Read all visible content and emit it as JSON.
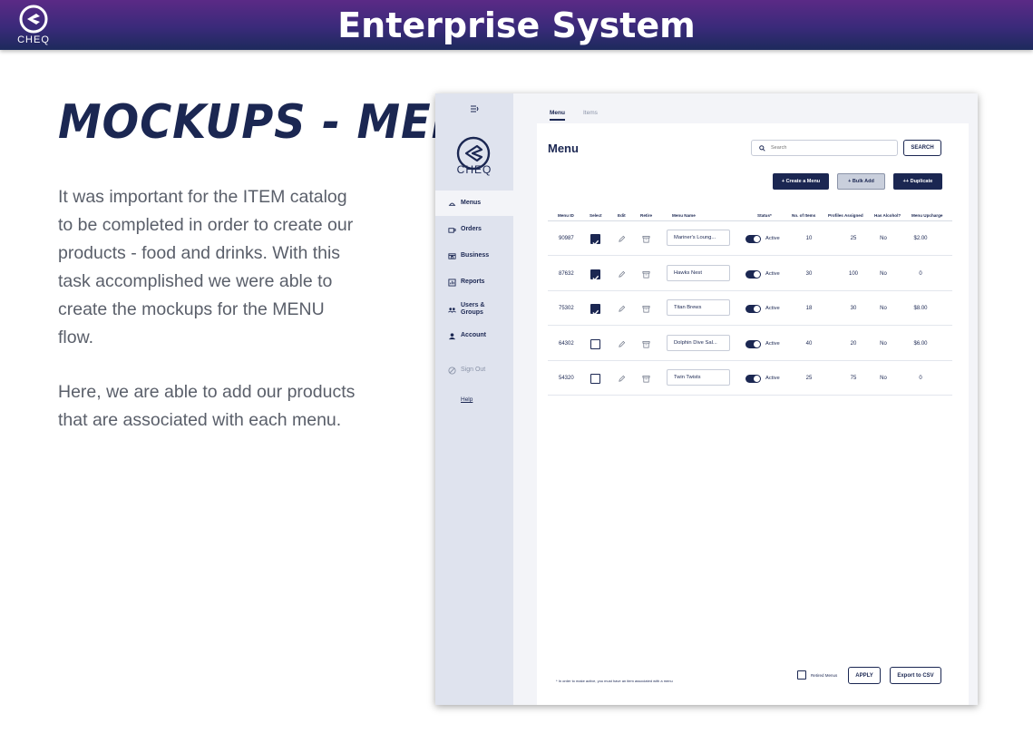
{
  "banner": {
    "logo_text": "CHEQ",
    "title": "Enterprise System",
    "logo_icon": "cheq-logo-icon"
  },
  "slide": {
    "heading": "MOCKUPS - MENU",
    "paragraph1": "It was important for the ITEM catalog to be completed in order to create our products - food and drinks. With this task accomplished we were able to create the mockups for the MENU flow.",
    "paragraph2": "Here, we are able to add our products that are associated with each menu."
  },
  "mockup": {
    "sidebar": {
      "logo_text": "CHEQ",
      "items": [
        {
          "label": "Menus",
          "icon": "menu-dish-icon",
          "active": true
        },
        {
          "label": "Orders",
          "icon": "coffee-cup-icon",
          "active": false
        },
        {
          "label": "Business",
          "icon": "store-icon",
          "active": false
        },
        {
          "label": "Reports",
          "icon": "chart-icon",
          "active": false
        },
        {
          "label": "Users & Groups",
          "icon": "users-icon",
          "active": false
        },
        {
          "label": "Account",
          "icon": "user-icon",
          "active": false
        }
      ],
      "sign_out": "Sign Out",
      "help": "Help"
    },
    "tabs": [
      {
        "label": "Menu",
        "active": true
      },
      {
        "label": "Items",
        "active": false
      }
    ],
    "page_title": "Menu",
    "search": {
      "placeholder": "Search",
      "button": "SEARCH"
    },
    "actions": {
      "create": "+ Create a Menu",
      "bulk": "+ Bulk Add",
      "duplicate": "++ Duplicate"
    },
    "table": {
      "headers": {
        "menu_id": "Menu ID",
        "select": "Select",
        "edit": "Edit",
        "retire": "Retire",
        "menu_name": "Menu Name",
        "status": "Status*",
        "items": "No. of Items",
        "profiles": "Profiles Assigned",
        "alcohol": "Has Alcohol?",
        "upcharge": "Menu Upcharge"
      },
      "rows": [
        {
          "id": "90987",
          "selected": true,
          "name": "Mariner's Loung...",
          "status": "Active",
          "items": "10",
          "profiles": "25",
          "alcohol": "No",
          "upcharge": "$2.00"
        },
        {
          "id": "87632",
          "selected": true,
          "name": "Hawks Nest",
          "status": "Active",
          "items": "30",
          "profiles": "100",
          "alcohol": "No",
          "upcharge": "0"
        },
        {
          "id": "75302",
          "selected": true,
          "name": "Titan Brews",
          "status": "Active",
          "items": "18",
          "profiles": "30",
          "alcohol": "No",
          "upcharge": "$8.00"
        },
        {
          "id": "64302",
          "selected": false,
          "name": "Dolphin Dive Sal...",
          "status": "Active",
          "items": "40",
          "profiles": "20",
          "alcohol": "No",
          "upcharge": "$6.00"
        },
        {
          "id": "54320",
          "selected": false,
          "name": "Twin Twists",
          "status": "Active",
          "items": "25",
          "profiles": "75",
          "alcohol": "No",
          "upcharge": "0"
        }
      ]
    },
    "footer": {
      "note": "* In order to make active, you must have an item associated with a menu",
      "retired_label": "Retired Menus",
      "apply": "APPLY",
      "export": "Export to CSV"
    },
    "colors": {
      "navy": "#1b2752",
      "sidebar_bg": "#dfe3ee",
      "banner_purple": "#5b2a86"
    }
  }
}
